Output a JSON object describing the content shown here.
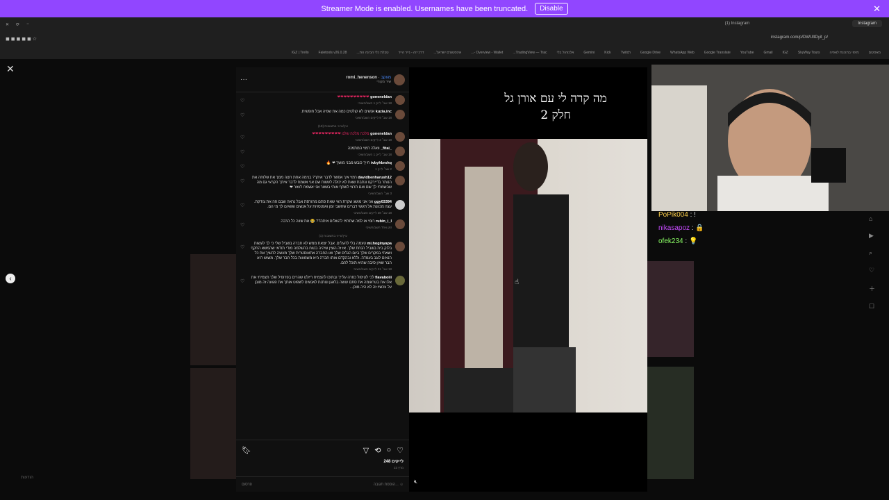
{
  "banner": {
    "text": "Streamer Mode is enabled. Usernames have been truncated.",
    "disable_label": "Disable"
  },
  "browser": {
    "tabs": [
      "(1) Instagram",
      "Instagram"
    ],
    "url": "instagram.com/p/DWUltDyit_p/",
    "bookmarks": [
      "IGZ | Trello",
      "Faletools v26.0.28",
      "טבלת כלי הבינה הת...",
      "דרכי זה - נייר הייר",
      "אינסטגרם ישראל...",
      "Overview - Wallet -...",
      "TradingView — Trac...",
      "אלכוהול בלי",
      "Gemini",
      "Kick",
      "Twitch",
      "Google Drive",
      "WhatsApp Web",
      "Google Translate",
      "YouTube",
      "Gmail",
      "IGZ",
      "SkyWay Tours",
      "מיפוי בתוכנת לאפיה",
      "מאסקים"
    ]
  },
  "post": {
    "author": "romi_henenson",
    "author_sub": "שיר מקורי",
    "follow": "מעקב",
    "comments": [
      {
        "user": "goneneldan",
        "text": "❤❤❤❤❤❤❤❤❤❤",
        "meta": "18 שב׳  לייק 1  השב/השיבי"
      },
      {
        "user": "kuzia.inc",
        "text": "אנשים לא קולטים כמה את שפיה אבל חופשית.",
        "meta": "18 שב׳  9 לייקים  השב/השיבי"
      },
      {
        "user": "goneneldan",
        "text": "מלכה מלכה שלנו ❤❤❤❤❤❤❤❤❤",
        "meta": "18 שב׳  2 לייקים  השב/השיבי"
      },
      {
        "user": "_fitai_",
        "text": "וואלה רמזי המתמנה",
        "meta": "18 שב׳  לייק 1  השב/השיבי"
      },
      {
        "user": "tvbyhbrshq",
        "text": "חייך כובש מבני מושך ❤ 🔥",
        "meta": "2 שב׳  לייק 1"
      },
      {
        "user": "davidbenharush12",
        "text": "רמזי איך אפשר לדבר איתך? בנימה אחת רוצה ממך את שלוחה את הנותר בדיירקט ונתבת שאת לא יכולה לעשות שם אני אשמח לדבר איתך הקראי גם מה שהשמתי לך שם ואם תרצי לשתף אותי בשאר אני אשמח לעזור ❤",
        "meta": "3 שב׳  השב/השיבי"
      },
      {
        "user": "ggy03394",
        "text": "אני אני מושג שקרת האי שאת סתם מהורסת אבל נראה שבם פה את צודקת. עצה מכוונת אל תעשי דברים שחשבי זמן ואפנסויות על אנשים שזואים לך מי הם.",
        "meta": "18 שב׳  38 לייקים  השב/השיבי"
      },
      {
        "user": "rubin_i_l",
        "text": "רומי או למה שתרמי להשלים איתה?? 😂 את שווה כל הרבה",
        "meta": "זמן אחד  השב/השיבי"
      },
      {
        "user": "mi.hoginyapa",
        "text": "טעמה בלי להעלים. אבל יוצאת ממש לא חברה בשביל שלי כי לך לעשות בלוק בית בשביל הנחת שלך. אז זה הוצין שיהיה בטוח בהשלמה מודי תודאי שהמשא התקף ושאתי במקרים שלך ביום הגלים שלך ואו החברה אתאוסטרית שלך מעשה להשיך את כל הנאים לוגב בעמדה. וללא ובהקדם אותו חברה היא משמעות בכל חבר שלך. משוש היא הבר שאין סיבה שהיא תוכל להם.",
        "meta": "18 שב׳  21 לייקים  השב/השיבי"
      },
      {
        "user": "flavaboiii",
        "text": "לכי לטיפול כפרה עלייך ובתוכו להצמיח ריזלט שהרים בפרופיל שלך תצמיחי את אלו את בטראומה את סתם עושה בלאגן ונותנת לאנשים לשפוט אותך את פגועה זה מובן על עכשיו זה לא היה מוכן...",
        "meta": ""
      }
    ],
    "view_replies_1": "עיין/עייני בתשובות (18)",
    "view_replies_2": "עיין/עייני בתשובות (1)",
    "likes": "248 לייקים",
    "date": "23 מרץ",
    "add_comment": "הוספת תגובה...",
    "post_btn": "פרסום",
    "video_title_1": "מה קרה לי עם אורן גל",
    "video_title_2": "חלק 2"
  },
  "chat": [
    {
      "user": "PoPik004",
      "msg": "!"
    },
    {
      "user": "nikasapoz",
      "msg": "🔒"
    },
    {
      "user": "ofek234",
      "msg": "💡"
    }
  ],
  "left_note": "הודעות"
}
